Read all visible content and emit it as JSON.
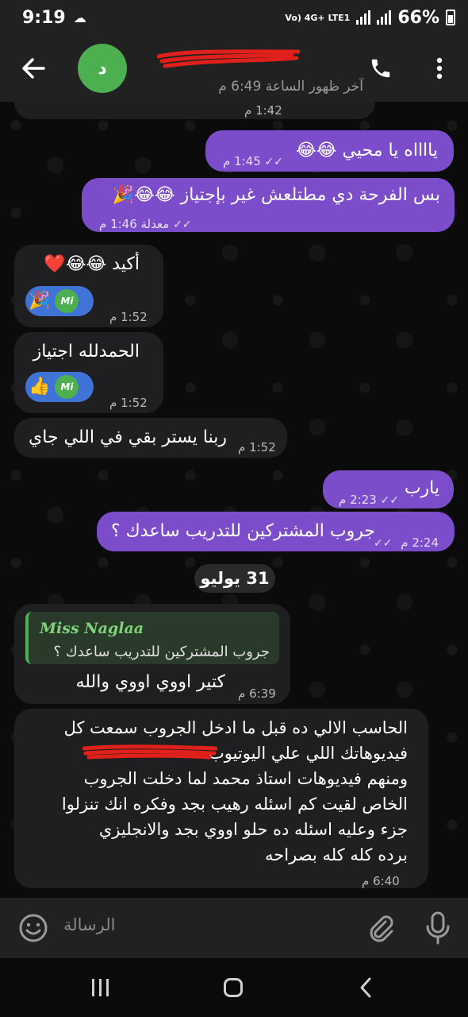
{
  "status_bar": {
    "time": "9:19",
    "network_label": "Vo) 4G+ LTE1",
    "battery": "66%"
  },
  "header": {
    "avatar_letter": "د",
    "last_seen": "آخر ظهور الساعة 6:49 م"
  },
  "messages": [
    {
      "id": "m0",
      "dir": "in",
      "text": "",
      "time": "1:42 م"
    },
    {
      "id": "m1",
      "dir": "out",
      "text": "يااااه يا محيي 😂😂",
      "time": "1:45 م"
    },
    {
      "id": "m2",
      "dir": "out",
      "text": "بس الفرحة دي مطتلعش غير بإجتياز 😂😂🎉",
      "time": "معدلة 1:46 م"
    },
    {
      "id": "m3",
      "dir": "in",
      "text": "أكيد 😂😂❤️",
      "time": "1:52 م",
      "reaction": "🎉",
      "reaction_user": "Mi"
    },
    {
      "id": "m4",
      "dir": "in",
      "text": "الحمدلله اجتياز",
      "time": "1:52 م",
      "reaction": "👍",
      "reaction_user": "Mi"
    },
    {
      "id": "m5",
      "dir": "in",
      "text": "ربنا يستر بقي في اللي جاي",
      "time": "1:52 م"
    },
    {
      "id": "m6",
      "dir": "out",
      "text": "يارب",
      "time": "2:23 م"
    },
    {
      "id": "m7",
      "dir": "out",
      "text": "جروب المشتركين للتدريب ساعدك ؟",
      "time": "2:24 م"
    },
    {
      "id": "m8",
      "dir": "in",
      "text": "كتير اووي اووي والله",
      "time": "6:39 م",
      "quote_name": "Miss Naglaa",
      "quote_text": "جروب المشتركين للتدريب ساعدك ؟"
    },
    {
      "id": "m9",
      "dir": "in",
      "lines": [
        "الحاسب الالي ده قبل ما ادخل الجروب سمعت كل",
        "فيديوهاتك اللي علي اليوتيوب",
        "ومنهم فيديوهات استاذ محمد لما دخلت الجروب",
        "الخاص لقيت كم اسئله رهيب بجد وفكره انك تنزلوا",
        "جزء وعليه اسئله ده حلو اووي بجد والانجليزي",
        "برده كله كله بصراحه"
      ],
      "time": "6:40 م"
    }
  ],
  "date_separator": "31 يوليو",
  "composer": {
    "placeholder": "الرسالة"
  },
  "colors": {
    "outgoing_bubble": "#7c4dcb",
    "incoming_bubble": "#1f1f22",
    "avatar": "#4caf50",
    "reaction_pill": "#3f74d6"
  }
}
